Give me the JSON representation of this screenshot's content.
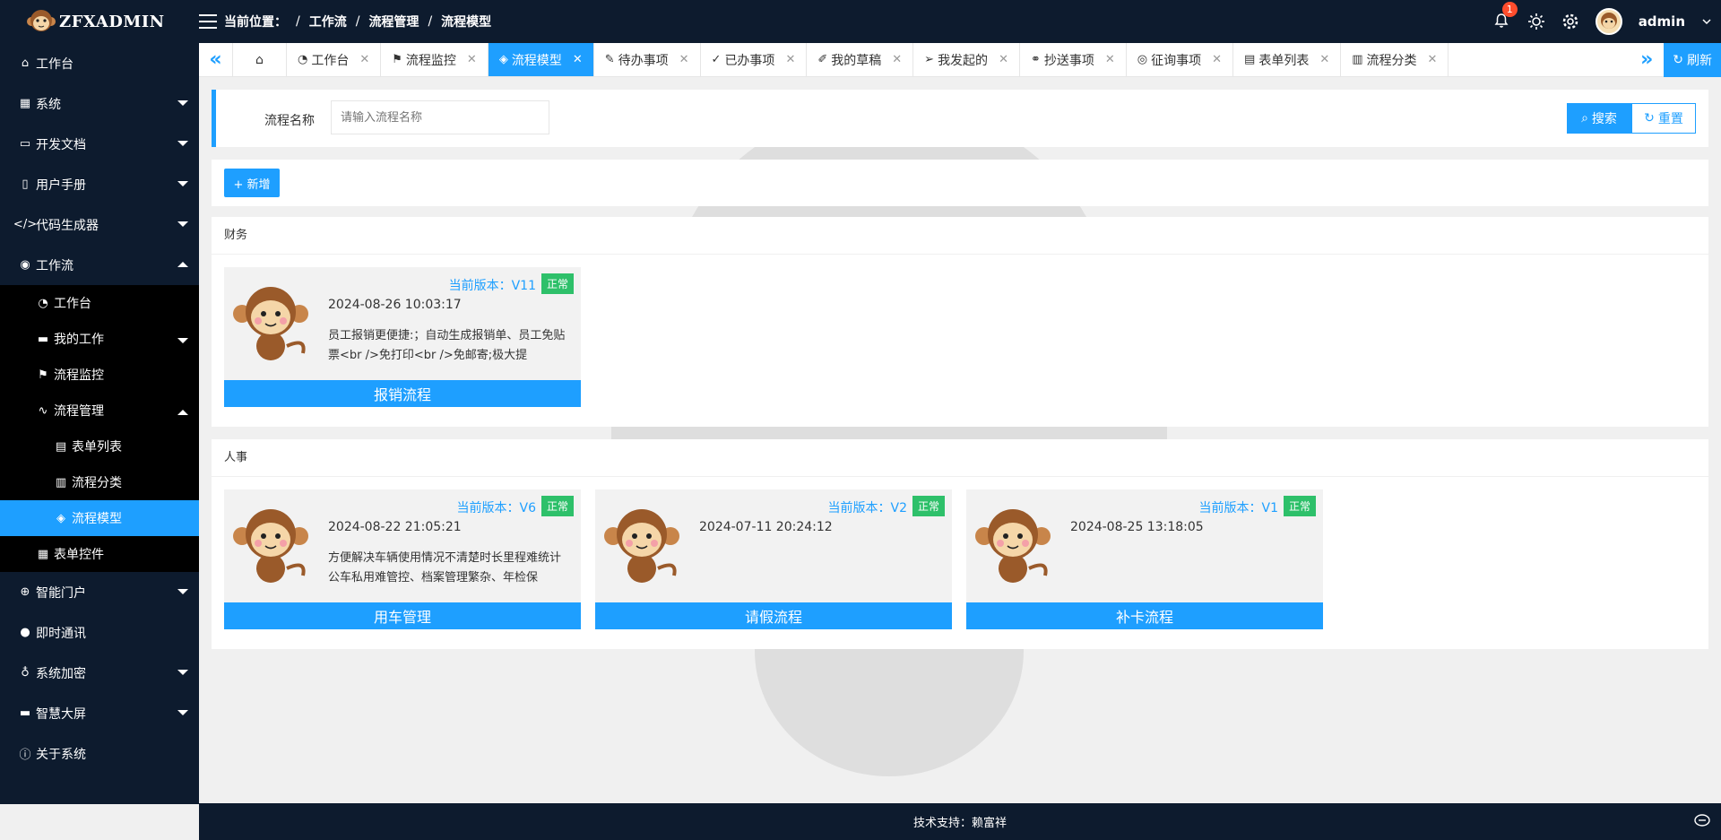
{
  "app": {
    "logo_text": "ZFXADMIN"
  },
  "header": {
    "breadcrumb_label": "当前位置：",
    "breadcrumb": [
      "工作流",
      "流程管理",
      "流程模型"
    ],
    "notification_count": "1",
    "username": "admin"
  },
  "sidebar": {
    "items": [
      {
        "label": "工作台",
        "icon": "home-icon"
      },
      {
        "label": "系统",
        "icon": "apps-icon"
      },
      {
        "label": "开发文档",
        "icon": "book-icon"
      },
      {
        "label": "用户手册",
        "icon": "manual-icon"
      },
      {
        "label": "代码生成器",
        "icon": "code-icon"
      },
      {
        "label": "工作流",
        "icon": "workflow-icon"
      },
      {
        "label": "智能门户",
        "icon": "globe-icon"
      },
      {
        "label": "即时通讯",
        "icon": "chat-icon"
      },
      {
        "label": "系统加密",
        "icon": "pin-icon"
      },
      {
        "label": "智慧大屏",
        "icon": "screen-icon"
      },
      {
        "label": "关于系统",
        "icon": "info-icon"
      }
    ],
    "workflow_sub": [
      {
        "label": "工作台",
        "icon": "dashboard-icon"
      },
      {
        "label": "我的工作",
        "icon": "briefcase-icon"
      },
      {
        "label": "流程监控",
        "icon": "flag-icon"
      },
      {
        "label": "流程管理",
        "icon": "pulse-icon"
      },
      {
        "label": "表单控件",
        "icon": "form-icon"
      }
    ],
    "manage_sub": [
      {
        "label": "表单列表",
        "icon": "list-icon"
      },
      {
        "label": "流程分类",
        "icon": "category-icon"
      },
      {
        "label": "流程模型",
        "icon": "layers-icon"
      }
    ]
  },
  "tabs": [
    {
      "label": "工作台",
      "icon": "dashboard-icon"
    },
    {
      "label": "流程监控",
      "icon": "flag-icon"
    },
    {
      "label": "流程模型",
      "icon": "layers-icon"
    },
    {
      "label": "待办事项",
      "icon": "pen-icon"
    },
    {
      "label": "已办事项",
      "icon": "check-icon"
    },
    {
      "label": "我的草稿",
      "icon": "brush-icon"
    },
    {
      "label": "我发起的",
      "icon": "send-icon"
    },
    {
      "label": "抄送事项",
      "icon": "link-icon"
    },
    {
      "label": "征询事项",
      "icon": "eye-icon"
    },
    {
      "label": "表单列表",
      "icon": "list-icon"
    },
    {
      "label": "流程分类",
      "icon": "category-icon"
    }
  ],
  "refresh_label": "刷新",
  "search": {
    "label": "流程名称",
    "placeholder": "请输入流程名称",
    "search_button": "搜索",
    "reset_button": "重置"
  },
  "toolbar": {
    "add_button": "+ 新增"
  },
  "groups": [
    {
      "title": "财务",
      "cards": [
        {
          "version": "当前版本：V11",
          "status": "正常",
          "date": "2024-08-26 10:03:17",
          "desc": "员工报销更便捷:；自动生成报销单、员工免贴票<br />免打印<br />免邮寄;极大提",
          "name": "报销流程"
        }
      ]
    },
    {
      "title": "人事",
      "cards": [
        {
          "version": "当前版本：V6",
          "status": "正常",
          "date": "2024-08-22 21:05:21",
          "desc": "方便解决车辆使用情况不清楚时长里程难统计公车私用难管控、档案管理繁杂、年检保",
          "name": "用车管理"
        },
        {
          "version": "当前版本：V2",
          "status": "正常",
          "date": "2024-07-11 20:24:12",
          "desc": "",
          "name": "请假流程"
        },
        {
          "version": "当前版本：V1",
          "status": "正常",
          "date": "2024-08-25 13:18:05",
          "desc": "",
          "name": "补卡流程"
        }
      ]
    }
  ],
  "footer": {
    "text": "技术支持：赖富祥"
  },
  "colors": {
    "accent": "#1e9fff",
    "nav_bg": "#0d1b2e",
    "status_ok": "#2ec06a",
    "badge": "#ff4d2d"
  }
}
